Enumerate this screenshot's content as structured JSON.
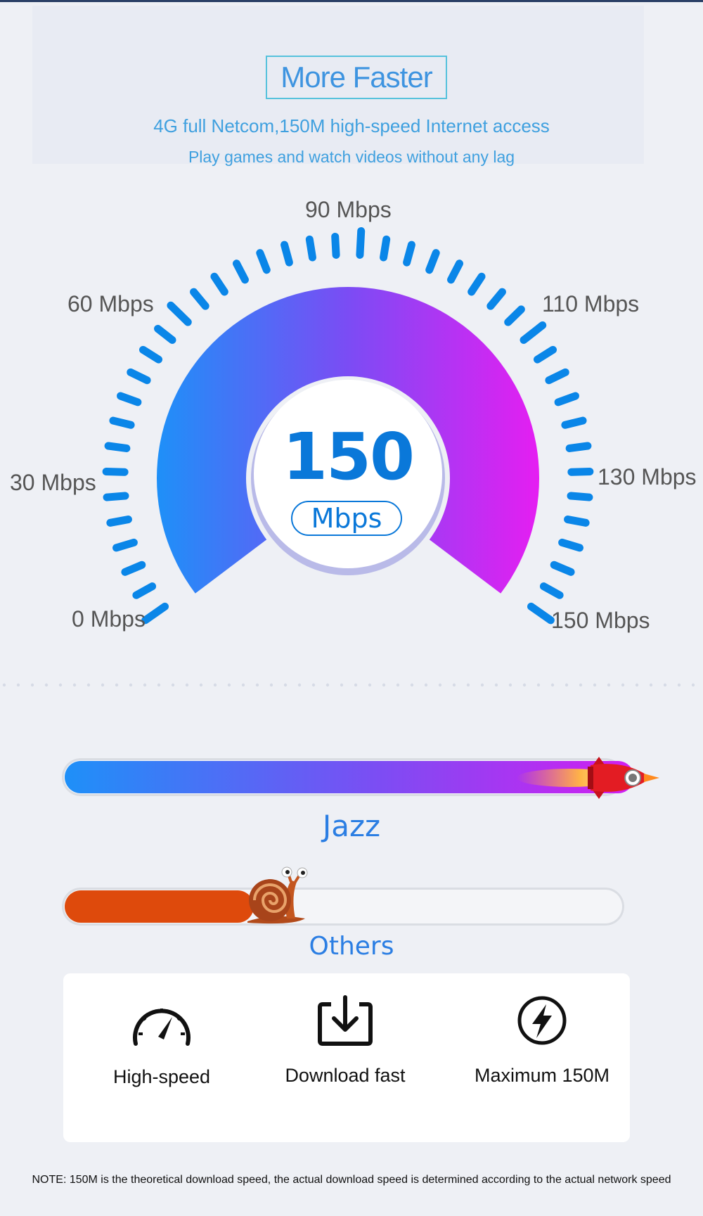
{
  "header": {
    "title": "More Faster",
    "subtitle_1": "4G full Netcom,150M high-speed Internet access",
    "subtitle_2": "Play games and watch videos without any lag"
  },
  "speedometer": {
    "labels": {
      "mbps_0": "0 Mbps",
      "mbps_30": "30 Mbps",
      "mbps_60": "60 Mbps",
      "mbps_90": "90 Mbps",
      "mbps_110": "110 Mbps",
      "mbps_130": "130 Mbps",
      "mbps_150": "150 Mbps"
    },
    "value": "150",
    "unit": "Mbps",
    "gradient_start_color": "#1e90f8",
    "gradient_end_color": "#e51ef2",
    "tick_color": "#0a86e8"
  },
  "comparison": {
    "jazz_label": "Jazz",
    "jazz_progress": 1.0,
    "jazz_icon": "rocket-icon",
    "others_label": "Others",
    "others_progress": 0.34,
    "others_icon": "snail-icon",
    "others_color": "#de4a0c"
  },
  "features": [
    {
      "icon": "speedometer-icon",
      "label": "High-speed"
    },
    {
      "icon": "download-icon",
      "label": "Download fast"
    },
    {
      "icon": "lightning-icon",
      "label": "Maximum 150M"
    }
  ],
  "note": "NOTE: 150M is the theoretical download speed, the actual download speed is determined according to the actual network speed"
}
